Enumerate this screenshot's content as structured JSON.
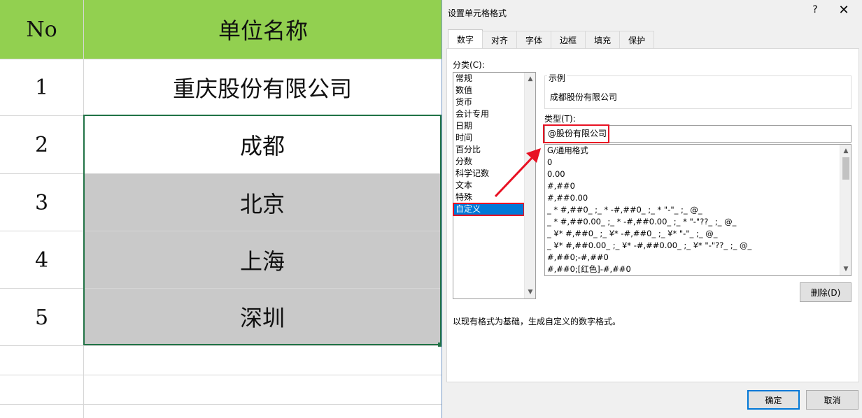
{
  "sheet": {
    "header": {
      "no": "No",
      "unit": "单位名称"
    },
    "rows": [
      {
        "no": "1",
        "unit": "重庆股份有限公司"
      },
      {
        "no": "2",
        "unit": "成都"
      },
      {
        "no": "3",
        "unit": "北京"
      },
      {
        "no": "4",
        "unit": "上海"
      },
      {
        "no": "5",
        "unit": "深圳"
      }
    ],
    "header_color": "#92d050",
    "selection_color": "#217346"
  },
  "dialog": {
    "title": "设置单元格格式",
    "help": "?",
    "close": "✕",
    "tabs": [
      "数字",
      "对齐",
      "字体",
      "边框",
      "填充",
      "保护"
    ],
    "active_tab": "数字",
    "category_label": "分类(C):",
    "categories": [
      "常规",
      "数值",
      "货币",
      "会计专用",
      "日期",
      "时间",
      "百分比",
      "分数",
      "科学记数",
      "文本",
      "特殊",
      "自定义"
    ],
    "selected_category": "自定义",
    "sample_label": "示例",
    "sample_value": "成都股份有限公司",
    "type_label": "类型(T):",
    "type_value": "@股份有限公司",
    "formats": [
      "G/通用格式",
      "0",
      "0.00",
      "#,##0",
      "#,##0.00",
      "_ * #,##0_ ;_ * -#,##0_ ;_ * \"-\"_ ;_ @_",
      "_ * #,##0.00_ ;_ * -#,##0.00_ ;_ * \"-\"??_ ;_ @_",
      "_ ¥* #,##0_ ;_ ¥* -#,##0_ ;_ ¥* \"-\"_ ;_ @_",
      "_ ¥* #,##0.00_ ;_ ¥* -#,##0.00_ ;_ ¥* \"-\"??_ ;_ @_",
      "#,##0;-#,##0",
      "#,##0;[红色]-#,##0"
    ],
    "delete_button": "删除(D)",
    "description": "以现有格式为基础，生成自定义的数字格式。",
    "ok_button": "确定",
    "cancel_button": "取消",
    "highlight_color": "#e81123",
    "selected_color": "#0078d7"
  }
}
